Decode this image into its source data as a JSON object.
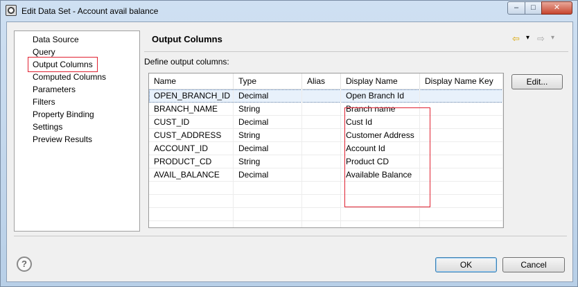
{
  "window": {
    "title": "Edit Data Set - Account avail balance",
    "min_glyph": "–",
    "max_glyph": "□",
    "close_glyph": "✕"
  },
  "nav": {
    "items": [
      {
        "label": "Data Source"
      },
      {
        "label": "Query"
      },
      {
        "label": "Output Columns"
      },
      {
        "label": "Computed Columns"
      },
      {
        "label": "Parameters"
      },
      {
        "label": "Filters"
      },
      {
        "label": "Property Binding"
      },
      {
        "label": "Settings"
      },
      {
        "label": "Preview Results"
      }
    ],
    "selected": "Output Columns"
  },
  "panel": {
    "title": "Output Columns",
    "define_label": "Define output columns:",
    "back_glyph": "⇦",
    "forward_glyph": "⇨",
    "dropdown_glyph": "▾"
  },
  "table": {
    "headers": [
      "Name",
      "Type",
      "Alias",
      "Display Name",
      "Display Name Key"
    ],
    "rows": [
      {
        "name": "OPEN_BRANCH_ID",
        "type": "Decimal",
        "alias": "",
        "display_name": "Open Branch Id",
        "display_name_key": ""
      },
      {
        "name": "BRANCH_NAME",
        "type": "String",
        "alias": "",
        "display_name": "Branch name",
        "display_name_key": ""
      },
      {
        "name": "CUST_ID",
        "type": "Decimal",
        "alias": "",
        "display_name": "Cust Id",
        "display_name_key": ""
      },
      {
        "name": "CUST_ADDRESS",
        "type": "String",
        "alias": "",
        "display_name": "Customer Address",
        "display_name_key": ""
      },
      {
        "name": "ACCOUNT_ID",
        "type": "Decimal",
        "alias": "",
        "display_name": "Account Id",
        "display_name_key": ""
      },
      {
        "name": "PRODUCT_CD",
        "type": "String",
        "alias": "",
        "display_name": "Product CD",
        "display_name_key": ""
      },
      {
        "name": "AVAIL_BALANCE",
        "type": "Decimal",
        "alias": "",
        "display_name": "Available Balance",
        "display_name_key": ""
      }
    ]
  },
  "buttons": {
    "edit": "Edit...",
    "ok": "OK",
    "cancel": "Cancel",
    "help_glyph": "?"
  },
  "icons": {
    "app": "eclipse-icon",
    "help": "help-icon",
    "back": "back-arrow-icon",
    "forward": "forward-arrow-icon"
  }
}
